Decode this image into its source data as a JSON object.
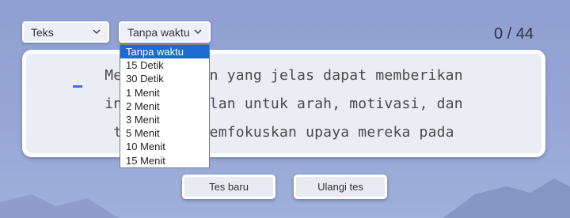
{
  "controls": {
    "mode_select": {
      "value": "Teks"
    },
    "time_select": {
      "value": "Tanpa waktu"
    }
  },
  "counter": "0 / 44",
  "text_lines": [
    "Menet      an yang jelas dapat memberikan",
    "indiv      alan untuk arah, motivasi, dan",
    "tujua     memfokuskan upaya mereka pada"
  ],
  "buttons": {
    "new_test": "Tes baru",
    "retry_test": "Ulangi tes"
  },
  "dropdown": {
    "options": [
      "Tanpa waktu",
      "15 Detik",
      "30 Detik",
      "1 Menit",
      "2 Menit",
      "3 Menit",
      "5 Menit",
      "10 Menit",
      "15 Menit"
    ],
    "selected_index": 0
  },
  "colors": {
    "accent": "#1c6ad6",
    "caret": "#3c6df0",
    "background": "#97a6d6"
  }
}
